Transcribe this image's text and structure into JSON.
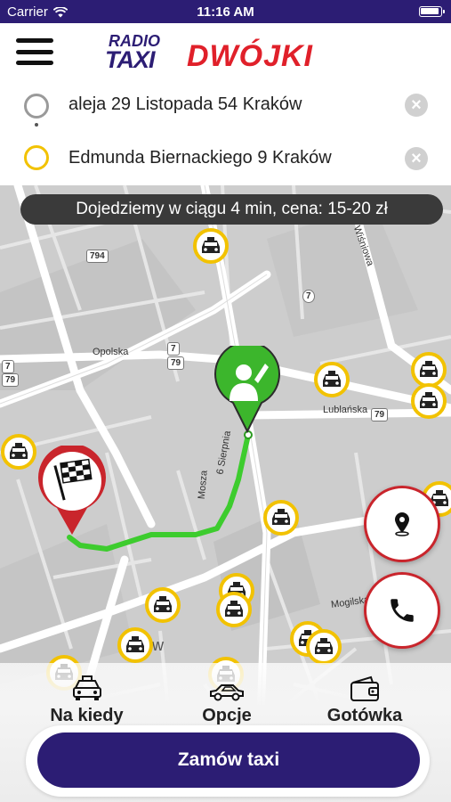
{
  "status_bar": {
    "carrier": "Carrier",
    "time": "11:16 AM"
  },
  "header": {
    "menu_icon": "hamburger-menu-icon",
    "logo": {
      "line1": "RADIO",
      "line2": "TAXI",
      "brand": "DWÓJKI"
    }
  },
  "route": {
    "from": {
      "address": "aleja 29 Listopada 54 Kraków",
      "clear_icon": "clear-icon"
    },
    "to": {
      "address": "Edmunda Biernackiego 9 Kraków",
      "clear_icon": "clear-icon"
    }
  },
  "map": {
    "eta_text": "Dojedziemy w ciągu 4 min, cena: 15-20 zł",
    "street_labels": [
      "Opolska",
      "Lublańska",
      "6 Sierpnia",
      "Mogilska",
      "Mosza",
      "Wiśniowa",
      "ków"
    ],
    "road_shields": [
      "794",
      "7",
      "79",
      "7",
      "79",
      "7",
      "79"
    ],
    "pickup_marker": "person-pin-icon",
    "destination_marker": "checkered-flag-pin-icon",
    "route_color": "#3dcc2e"
  },
  "map_actions": {
    "locate_button_icon": "location-pin-icon",
    "call_button_icon": "phone-icon"
  },
  "options": [
    {
      "icon": "taxi-front-icon",
      "label": "Na kiedy"
    },
    {
      "icon": "car-side-icon",
      "label": "Opcje"
    },
    {
      "icon": "wallet-icon",
      "label": "Gotówka"
    }
  ],
  "order_button": {
    "label": "Zamów taxi"
  },
  "colors": {
    "brand_navy": "#2c1d74",
    "brand_red": "#e0202a",
    "taxi_yellow": "#f2c200",
    "pickup_green": "#3cb62c",
    "destination_red": "#c9252c"
  }
}
